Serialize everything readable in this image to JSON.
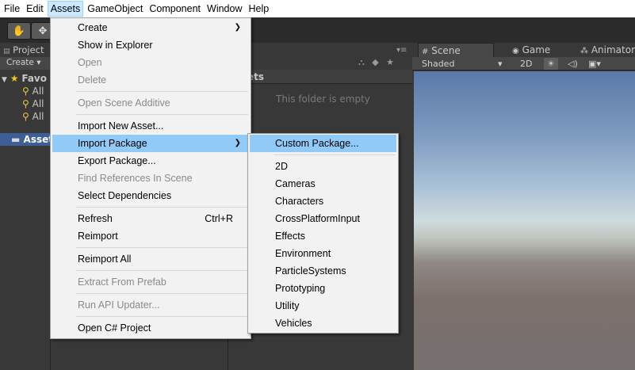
{
  "menubar": {
    "items": [
      "File",
      "Edit",
      "Assets",
      "GameObject",
      "Component",
      "Window",
      "Help"
    ],
    "active": "Assets"
  },
  "toolbar": {
    "hand_glyph": "✋",
    "move_glyph": "✥"
  },
  "project_panel": {
    "tab_label": "Project",
    "create_label": "Create ▾",
    "favorites_label": "Favo",
    "favorites_items": [
      "All",
      "All",
      "All"
    ],
    "assets_label": "Asset"
  },
  "assets_area": {
    "header": "ets",
    "empty_text": "This folder is empty"
  },
  "scene_panel": {
    "tabs": {
      "scene": "Scene",
      "game": "Game",
      "animator": "Animator"
    },
    "shading_label": "Shaded",
    "mode_2d": "2D"
  },
  "assets_menu": {
    "items": [
      {
        "label": "Create",
        "submenu": true
      },
      {
        "label": "Show in Explorer"
      },
      {
        "label": "Open",
        "disabled": true
      },
      {
        "label": "Delete",
        "disabled": true
      },
      {
        "label": "Open Scene Additive",
        "disabled": true
      },
      {
        "label": "Import New Asset..."
      },
      {
        "label": "Import Package",
        "submenu": true,
        "highlight": true
      },
      {
        "label": "Export Package..."
      },
      {
        "label": "Find References In Scene",
        "disabled": true
      },
      {
        "label": "Select Dependencies"
      },
      {
        "label": "Refresh",
        "shortcut": "Ctrl+R"
      },
      {
        "label": "Reimport"
      },
      {
        "label": "Reimport All"
      },
      {
        "label": "Extract From Prefab",
        "disabled": true
      },
      {
        "label": "Run API Updater...",
        "disabled": true
      },
      {
        "label": "Open C# Project"
      }
    ]
  },
  "import_submenu": {
    "items": [
      {
        "label": "Custom Package...",
        "highlight": true
      },
      {
        "label": "2D"
      },
      {
        "label": "Cameras"
      },
      {
        "label": "Characters"
      },
      {
        "label": "CrossPlatformInput"
      },
      {
        "label": "Effects"
      },
      {
        "label": "Environment"
      },
      {
        "label": "ParticleSystems"
      },
      {
        "label": "Prototyping"
      },
      {
        "label": "Utility"
      },
      {
        "label": "Vehicles"
      }
    ]
  },
  "colors": {
    "menu_highlight": "#91c9f7",
    "menubar_active": "#cce8ff",
    "selection_blue": "#3e5f96",
    "editor_bg": "#383838"
  }
}
